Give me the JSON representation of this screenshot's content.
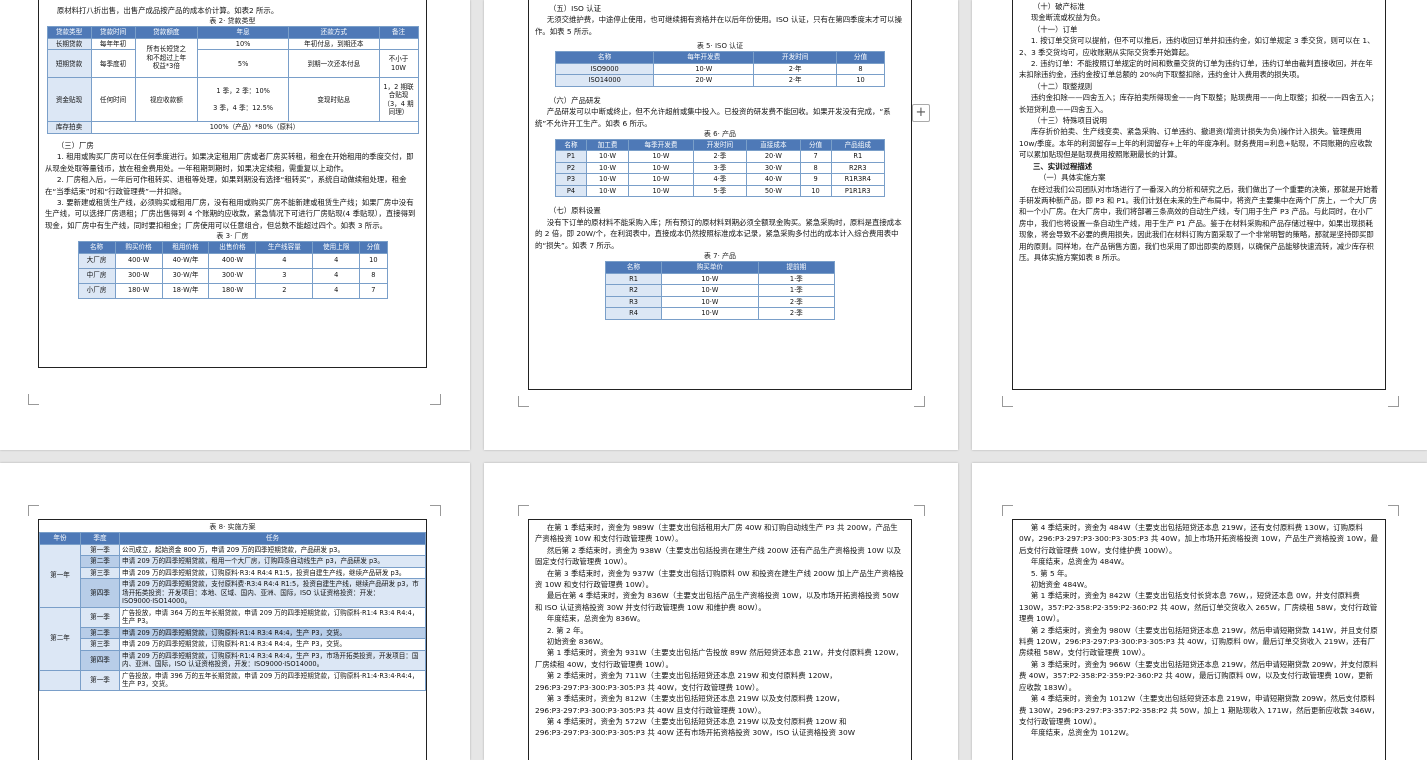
{
  "p1": {
    "intro": "原材料打八折出售，出售产成品按产品的成本价计算。如表2 所示。",
    "table2_caption": "表 2· 贷款类型",
    "table2_headers": [
      "贷款类型",
      "贷款时间",
      "贷款额度",
      "年息",
      "还款方式",
      "备注"
    ],
    "table2": {
      "r1_type": "长期贷款",
      "r1_time": "每年年初",
      "limit_a": "所有长短贷之",
      "limit_b": "和不超过上年",
      "limit_c": "权益*3倍",
      "r1_rate": "10%",
      "r1_repay": "年初付息，到期还本",
      "r2_type": "短期贷款",
      "r2_time": "每季度初",
      "r2_rate": "5%",
      "r2_repay": "到期一次还本付息",
      "r2_note": "不小于 10W",
      "r3_type": "资金贴现",
      "r3_time": "任何时间",
      "r3_limit": "视应收款额",
      "r3_rate_a": "1 季，2 季：10%",
      "r3_rate_b": "3 季，4 季：12.5%",
      "r3_repay": "变现时贴息",
      "r3_note": "1，2 期联合贴现（3，4 期同理）",
      "r4_type": "库存拍卖",
      "r4_value": "100%（产品）*80%（原料）"
    },
    "s3_title": "（三）厂房",
    "para1": "1. 租用或购买厂房可以在任何季度进行。如果决定租用厂房或者厂房买转租，租金在开始租用的季度交付，即从现金处取等量钱币，放在租金费用处。一年租期到期时，如果决定续租，需重复以上动作。",
    "para2": "2. 厂房租入后，一年后可作租转买、退租等处理，如果到期没有选择“租转买”，系统自动做续租处理，租金在“当季结束”时和“行政管理费”一并扣除。",
    "para3": "3. 要新建或租赁生产线，必须购买或租用厂房，没有租用或购买厂房不能新建或租赁生产线；如果厂房中没有生产线，可以选择厂房退租；厂房出售得到 4 个账期的应收款，紧急情况下可进行厂房贴现(4 季贴现），直接得到现金，如厂房中有生产线，同时要扣租金；厂房使用可以任意组合，但总数不能超过四个。如表 3 所示。",
    "table3_caption": "表 3· 厂房",
    "table3_headers": [
      "名称",
      "购买价格",
      "租用价格",
      "出售价格",
      "生产线容量",
      "使用上限",
      "分值"
    ],
    "table3_rows": [
      [
        "大厂房",
        "400·W",
        "40·W/年",
        "400·W",
        "4",
        "4",
        "10"
      ],
      [
        "中厂房",
        "300·W",
        "30·W/年",
        "300·W",
        "3",
        "4",
        "8"
      ],
      [
        "小厂房",
        "180·W",
        "18·W/年",
        "180·W",
        "2",
        "4",
        "7"
      ]
    ]
  },
  "p2": {
    "s5_title": "（五）ISO 认证",
    "s5_para": "无须交维护费，中途停止使用，也可继续拥有资格并在以后年份使用。ISO 认证，只有在第四季度末才可以操作。如表 5 所示。",
    "table5_caption": "表 5· ISO 认证",
    "table5_headers": [
      "名称",
      "每年开发费",
      "开发时间",
      "分值"
    ],
    "table5_rows": [
      [
        "ISO9000",
        "10·W",
        "2·年",
        "8"
      ],
      [
        "ISO14000",
        "20·W",
        "2·年",
        "10"
      ]
    ],
    "s6_title": "（六）产品研发",
    "s6_para": "产品研发可以中断或终止，但不允许超前或集中投入。已投资的研发费不能回收。如果开发没有完成，“系统”不允许开工生产。如表 6 所示。",
    "table6_caption": "表 6· 产品",
    "table6_headers": [
      "名称",
      "加工费",
      "每季开发费",
      "开发时间",
      "直接成本",
      "分值",
      "产品组成"
    ],
    "table6_rows": [
      [
        "P1",
        "10·W",
        "10·W",
        "2·季",
        "20·W",
        "7",
        "R1"
      ],
      [
        "P2",
        "10·W",
        "10·W",
        "3·季",
        "30·W",
        "8",
        "R2R3"
      ],
      [
        "P3",
        "10·W",
        "10·W",
        "4·季",
        "40·W",
        "9",
        "R1R3R4"
      ],
      [
        "P4",
        "10·W",
        "10·W",
        "5·季",
        "50·W",
        "10",
        "P1R1R3"
      ]
    ],
    "s7_title": "（七）原料设置",
    "s7_para": "没有下订单的原材料不能采购入库；所有预订的原材料到期必须全额现金购买。紧急采购时，原料是直接成本的 2 倍，即 20W/个，在利润表中，直接成本仍然按照标准成本记录，紧急采购多付出的成本计入综合费用表中的“损失”。如表 7 所示。",
    "table7_caption": "表 7· 产品",
    "table7_headers": [
      "名称",
      "购买单价",
      "提前期"
    ],
    "table7_rows": [
      [
        "R1",
        "10·W",
        "1·季"
      ],
      [
        "R2",
        "10·W",
        "1·季"
      ],
      [
        "R3",
        "10·W",
        "2·季"
      ],
      [
        "R4",
        "10·W",
        "2·季"
      ]
    ]
  },
  "p3": {
    "s10_title": "（十）破产标准",
    "s10_para": "现金断流或权益为负。",
    "s11_title": "（十一）订单",
    "s11_p1": "1. 按订单交货可以提前，但不可以推后，违约收回订单并扣违约金，如订单规定 3 季交货，则可以在 1、2、3 季交货均可，应收账期从实际交货季开始算起。",
    "s11_p2": "2. 违约订单：不能按照订单规定的时间和数量交货的订单为违约订单，违约订单由裁判直接收回，并在年末扣除违约金，违约金按订单总额的 20%向下取整扣除，违约金计入费用表的损失项。",
    "s12_title": "（十二）取整规则",
    "s12_para": "违约金扣除——四舍五入；库存拍卖所得现金——向下取整；贴现费用——向上取整；扣税——四舍五入；长短贷利息——四舍五入。",
    "s13_title": "（十三）特殊项目说明",
    "s13_para": "库存折价拍卖、生产线变卖、紧急采购、订单违约、撤退资(增资计损失为负)操作计入损失。管理费用 10w/季度。本年的利润留存=上年的利润留存+上年的年度净利。财务费用=利息+贴现，不同账期的应收款可以累加贴现但是贴现费用按照账期最长的计算。",
    "s3_title": "三、实训过程描述",
    "s3_sub": "（一）具体实施方案",
    "s3_para": "在经过我们公司团队对市场进行了一番深入的分析和研究之后，我们做出了一个重要的决策，那就是开始着手研发两种新产品，即 P3 和 P1。我们计划在未来的生产布局中，将资产主要集中在两个厂房上，一个大厂房和一个小厂房。在大厂房中，我们将部署三条高效的自动生产线，专门用于生产 P3 产品。与此同时，在小厂房中，我们也将设置一条自动生产线，用于生产 P1 产品。鉴于在材料采购和产品存储过程中，如果出现损耗现象，将会导致不必要的费用损失，因此我们在材料订购方面采取了一个非常明智的策略，那就是坚持即买即用的原则。同样地，在产品销售方面，我们也采用了即出即卖的原则，以确保产品能够快速流转，减少库存积压。具体实施方案如表 8 所示。"
  },
  "p4": {
    "table8_caption": "表 8· 实施方案",
    "table8_headers": [
      "年份",
      "季度",
      "任务"
    ],
    "year1": "第一年",
    "year2": "第二年",
    "q1": "第一季",
    "q2": "第二季",
    "q3": "第三季",
    "q4": "第四季",
    "y1q1": "公司成立，起始资金 800 万，申请 209 万的四季短期贷款，产品研发 p3。",
    "y1q2": "申请 209 万的四季短期贷款，租用一个大厂房，订购四条自动线生产 p3，产品研发 p3。",
    "y1q3": "申请 209 万的四季短期贷款，订购原料·R3:4 R4:4 R1:5，投资自建生产线，继续产品研发 p3。",
    "y1q4": "申请 209 万的四季短期贷款，支付原料费·R3:4 R4:4 R1:5，投资自建生产线，继续产品研发 p3，市场开拓类投资：开发项目：本地、区域、国内、亚洲、国际，ISO 认证资格投资：开发：ISO9000·ISO14000。",
    "y2q1": "广告投放，申请 364 万的五年长期贷款，申请 209 万的四季短期贷款，订购原料·R1:4 R3:4 R4:4，生产 P3。",
    "y2q2": "申请 209 万的四季短期贷款，订购原料·R1:4 R3:4 R4:4，生产 P3，交货。",
    "y2q3": "申请 209 万的四季短期贷款，订购原料·R1:4 R3:4 R4:4，生产 P3，交货。",
    "y2q4": "申请 209 万的四季短期贷款，订购原料·R1:4 R3:4 R4:4，生产 P3，市场开拓类投资，开发项目：国内、亚洲、国际，ISO 认证资格投资，开发：ISO9000·ISO14000。",
    "y3q1": "广告投放，申请 396 万的五年长期贷款，申请 209 万的四季短期贷款，订购原料·R1:4·R3:4·R4:4，生产 P3，交货。"
  },
  "p5": {
    "lines": [
      "在第 1 季结束时，资金为 989W（主要支出包括租用大厂房 40W 和订购自动线生产 P3 共 200W，产品生产资格投资 10W 和支付行政管理费 10W）。",
      "然后第 2 季结束时，资金为 938W（主要支出包括投资在建生产线 200W 还有产品生产资格投资 10W 以及固定支付行政管理费 10W）。",
      "在第 3 季结束时，资金为 937W（主要支出包括订购原料 0W 和投资在建生产线 200W 加上产品生产资格投资 10W 和支付行政管理费 10W）。",
      "最后在第 4 季结束时，资金为 836W（主要支出包括产品生产资格投资 10W，以及市场开拓资格投资 50W 和 ISO 认证资格投资 30W 并支付行政管理费 10W 和维护费 80W）。",
      "年度结束，总资金为 836W。",
      "2. 第 2 年。",
      "初始资金 836W。",
      "第 1 季结束时，资金为 931W（主要支出包括广告投放 89W 然后短贷还本息 21W，并支付原料费 120W，厂房续租 40W，支付行政管理费 10W）。",
      "第 2 季结束时，资金为 711W（主要支出包括短贷还本息 219W 和支付原料费 120W，296:P3·297:P3·300:P3·305:P3 共 40W，支付行政管理费 10W）。",
      "第 3 季结束时，资金为 812W（主要支出包括短贷还本息 219W 以及支付原料费 120W，296:P3·297:P3·300:P3·305:P3 共 40W 且支付行政管理费 10W）。",
      "第 4 季结束时，资金为 572W（主要支出包括短贷还本息 219W 以及支付原料费 120W 和 296:P3·297:P3·300:P3·305:P3 共 40W 还有市场开拓资格投资 30W，ISO 认证资格投资 30W"
    ]
  },
  "p6": {
    "lines": [
      "第 4 季结束时，资金为 484W（主要支出包括短贷还本息 219W，还有支付原料费 130W，订购原料 0W，296:P3·297:P3·300:P3·305:P3 共 40W，加上市场开拓资格投资 10W，产品生产资格投资 10W，最后支付行政管理费 10W，支付维护费 100W）。",
      "年度结束，总资金为 484W。",
      "5. 第 5 年。",
      "初始资金 484W。",
      "第 1 季结束时，资金为 842W（主要支出包括支付长贷本息 76W，，短贷还本息 0W，并支付原料费 130W，357:P2·358:P2·359:P2·360:P2 共 40W，然后订单交货收入 265W，厂房续租 58W，支付行政管理费 10W）。",
      "第 2 季结束时，资金为 980W（主要支出包括短贷还本息 219W，然后申请短期贷款 141W，并且支付原料费 120W，296:P3·297:P3·300:P3·305:P3 共 40W，订购原料 0W，最后订单交货收入 219W，还有厂房续租 58W，支付行政管理费 10W）。",
      "第 3 季结束时，资金为 966W（主要支出包括短贷还本息 219W，然后申请短期贷款 209W，并支付原料费 40W，357:P2·358:P2·359:P2·360:P2 共 40W，最后订购原料 0W，以及支付行政管理费 10W，更新应收款 183W）。",
      "第 4 季结束时，资金为 1012W（主要支出包括短贷还本息 219W，申请短期贷款 209W，然后支付原料费 130W，296:P3·297:P3·357:P2·358:P2 共 50W，加上 1 期贴现收入 171W，然后更新应收款 346W，支付行政管理费 10W）。",
      "年度结束，总资金为 1012W。"
    ]
  },
  "colors": {
    "header": "#4e79b7",
    "label_cell": "#dce7f5",
    "highlight": "#b8cde8",
    "background": "#e6e6e6"
  }
}
